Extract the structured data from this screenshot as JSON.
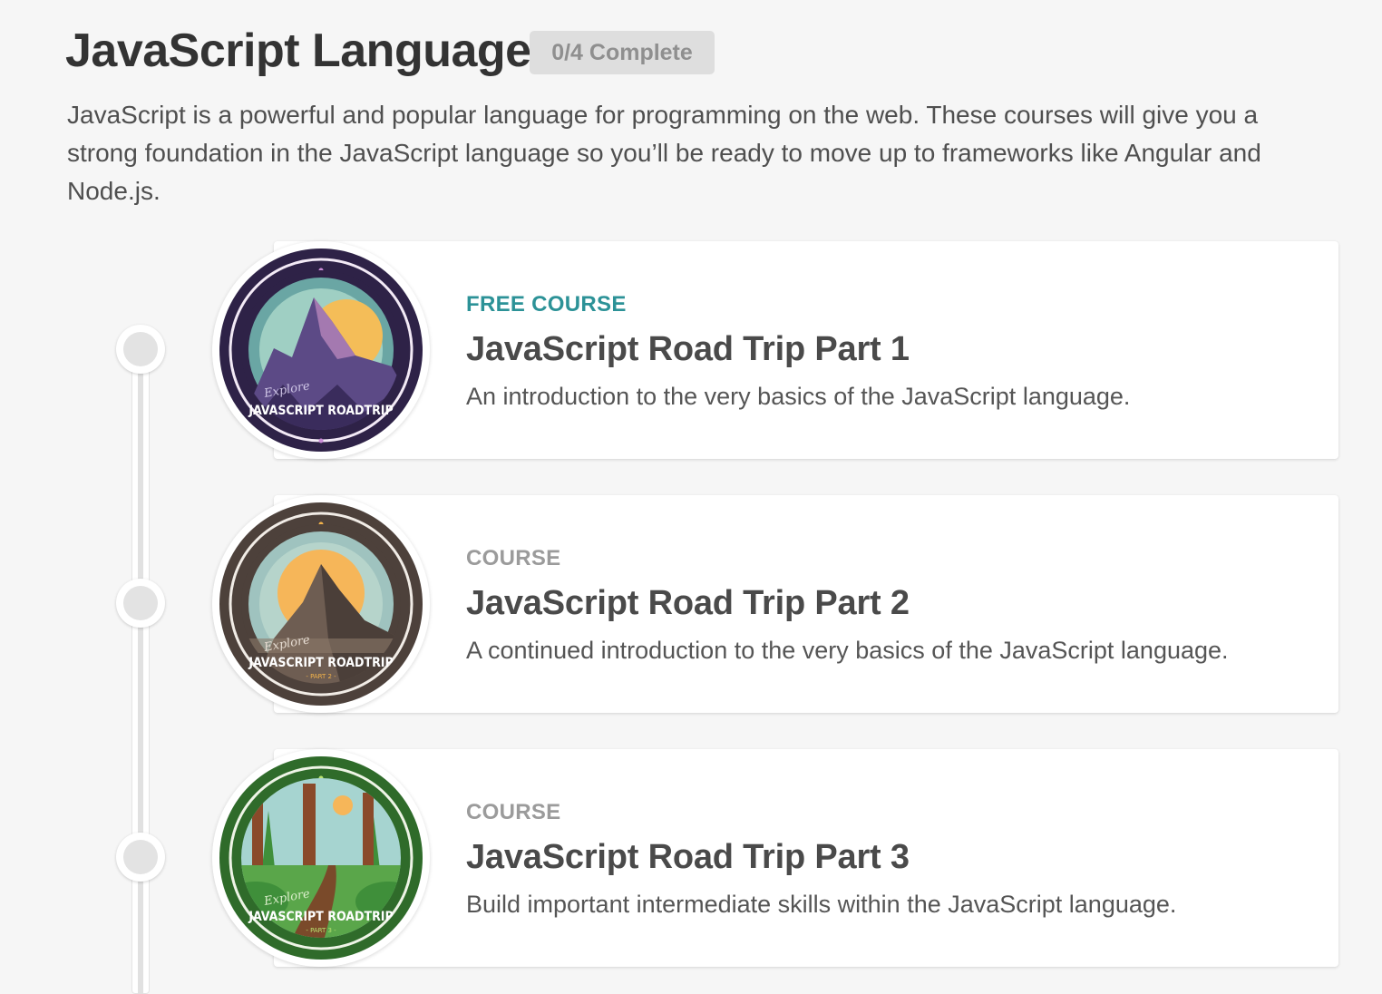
{
  "header": {
    "title": "JavaScript Language",
    "progress_badge": "0/4 Complete",
    "description": "JavaScript is a powerful and popular language for programming on the web. These courses will give you a strong foundation in the JavaScript language so you’ll be ready to move up to frameworks like Angular and Node.js."
  },
  "courses": [
    {
      "kind": "FREE COURSE",
      "title": "JavaScript Road Trip Part 1",
      "description": "An introduction to the very basics of the JavaScript language.",
      "badge_text_script": "Explore",
      "badge_text_main": "JAVASCRIPT ROADTRIP",
      "badge_text_sub": "",
      "theme_color": "#2e2247"
    },
    {
      "kind": "COURSE",
      "title": "JavaScript Road Trip Part 2",
      "description": "A continued introduction to the very basics of the JavaScript language.",
      "badge_text_script": "Explore",
      "badge_text_main": "JAVASCRIPT ROADTRIP",
      "badge_text_sub": "- PART 2 -",
      "theme_color": "#4d413b"
    },
    {
      "kind": "COURSE",
      "title": "JavaScript Road Trip Part 3",
      "description": "Build important intermediate skills within the JavaScript language.",
      "badge_text_script": "Explore",
      "badge_text_main": "JAVASCRIPT ROADTRIP",
      "badge_text_sub": "- PART 3 -",
      "theme_color": "#2f6b2a"
    }
  ],
  "colors": {
    "free_label": "#2c9297",
    "course_label": "#9b9b9b",
    "page_background": "#f6f6f6"
  }
}
